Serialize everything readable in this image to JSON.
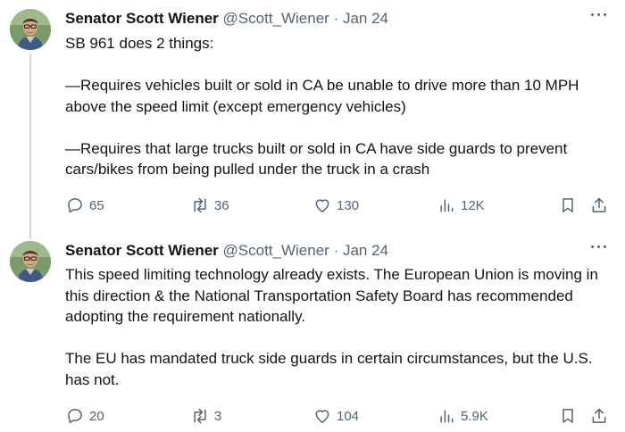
{
  "tweets": [
    {
      "author_name": "Senator Scott Wiener",
      "handle": "@Scott_Wiener",
      "separator": "·",
      "date": "Jan 24",
      "text": "SB 961 does 2 things:\n\n—Requires vehicles built or sold in CA be unable to drive more than 10 MPH above the speed limit (except emergency vehicles)\n\n—Requires that large trucks built or sold in CA have side guards to prevent cars/bikes from being pulled under the truck in a crash",
      "replies": "65",
      "reposts": "36",
      "likes": "130",
      "views": "12K"
    },
    {
      "author_name": "Senator Scott Wiener",
      "handle": "@Scott_Wiener",
      "separator": "·",
      "date": "Jan 24",
      "text": "This speed limiting technology already exists. The European Union is moving in this direction & the National Transportation Safety Board has recommended adopting the requirement nationally.\n\nThe EU has mandated truck side guards in certain circumstances, but the U.S. has not.",
      "replies": "20",
      "reposts": "3",
      "likes": "104",
      "views": "5.9K"
    }
  ],
  "icons": {
    "reply": "reply-icon",
    "repost": "repost-icon",
    "like": "heart-icon",
    "views": "views-icon",
    "bookmark": "bookmark-icon",
    "share": "share-icon",
    "more": "more-icon"
  },
  "colors": {
    "text": "#0f1419",
    "secondary": "#536471",
    "thread_line": "#cfd9de"
  }
}
